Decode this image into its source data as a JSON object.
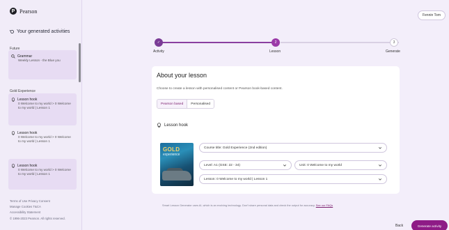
{
  "app": {
    "brand": "Pearson"
  },
  "sidebar": {
    "title": "Your generated activities",
    "future_label": "Future",
    "future_item": {
      "title": "Grammar",
      "subtitle": "Weekly Lesson - the Blue you"
    },
    "gold_label": "Gold Experience",
    "items": [
      {
        "title": "Lesson hook",
        "subtitle": "0 Welcome to my world > 0 Welcome to my world | Lesson 1"
      },
      {
        "title": "Lesson hook",
        "subtitle": "0 Welcome to my world > 0 Welcome to my world | Lesson 1"
      },
      {
        "title": "Lesson hook",
        "subtitle": "0 Welcome to my world > 0 Welcome to my world | Lesson 1"
      }
    ],
    "footer": [
      "Terms of Use   Privacy   Consent",
      "Manage Cookies   T&CA",
      "Accessibility Statement",
      "© 1996-2023 Pearson. All rights reserved."
    ]
  },
  "topbar": {
    "user_button": "Fennin Tom"
  },
  "stepper": {
    "steps": [
      {
        "label": "Activity",
        "marker": "✓",
        "state": "done"
      },
      {
        "label": "Lesson",
        "marker": "2",
        "state": "active"
      },
      {
        "label": "Generate",
        "marker": "3",
        "state": "pending"
      }
    ]
  },
  "card": {
    "title": "About your lesson",
    "description": "Choose to create a lesson with personalised content or Pearson book-based content.",
    "tabs": [
      "Pearson based",
      "Personalised"
    ],
    "active_tab": "Pearson based",
    "section_title": "Lesson hook",
    "cover": {
      "title": "GOLD",
      "subtitle": "experience"
    },
    "selects": {
      "course": "Course title: Gold Experience (2nd edition)",
      "level": "Level: A1 (GSE: 22 - 34)",
      "unit": "Unit: 0 Welcome to my world",
      "lesson": "Lesson: 0 Welcome to my world | Lesson 1"
    }
  },
  "disclaimer": {
    "text": "Smart Lesson Generator uses AI, which is an evolving technology. Don't share personal data and check the output for accuracy.",
    "link": "See our FAQs"
  },
  "footer_actions": {
    "back": "Back",
    "generate": "Generate activity"
  },
  "colors": {
    "accent": "#8e1b86",
    "active_step": "#9b3aa8",
    "done_step": "#7a3b96"
  }
}
